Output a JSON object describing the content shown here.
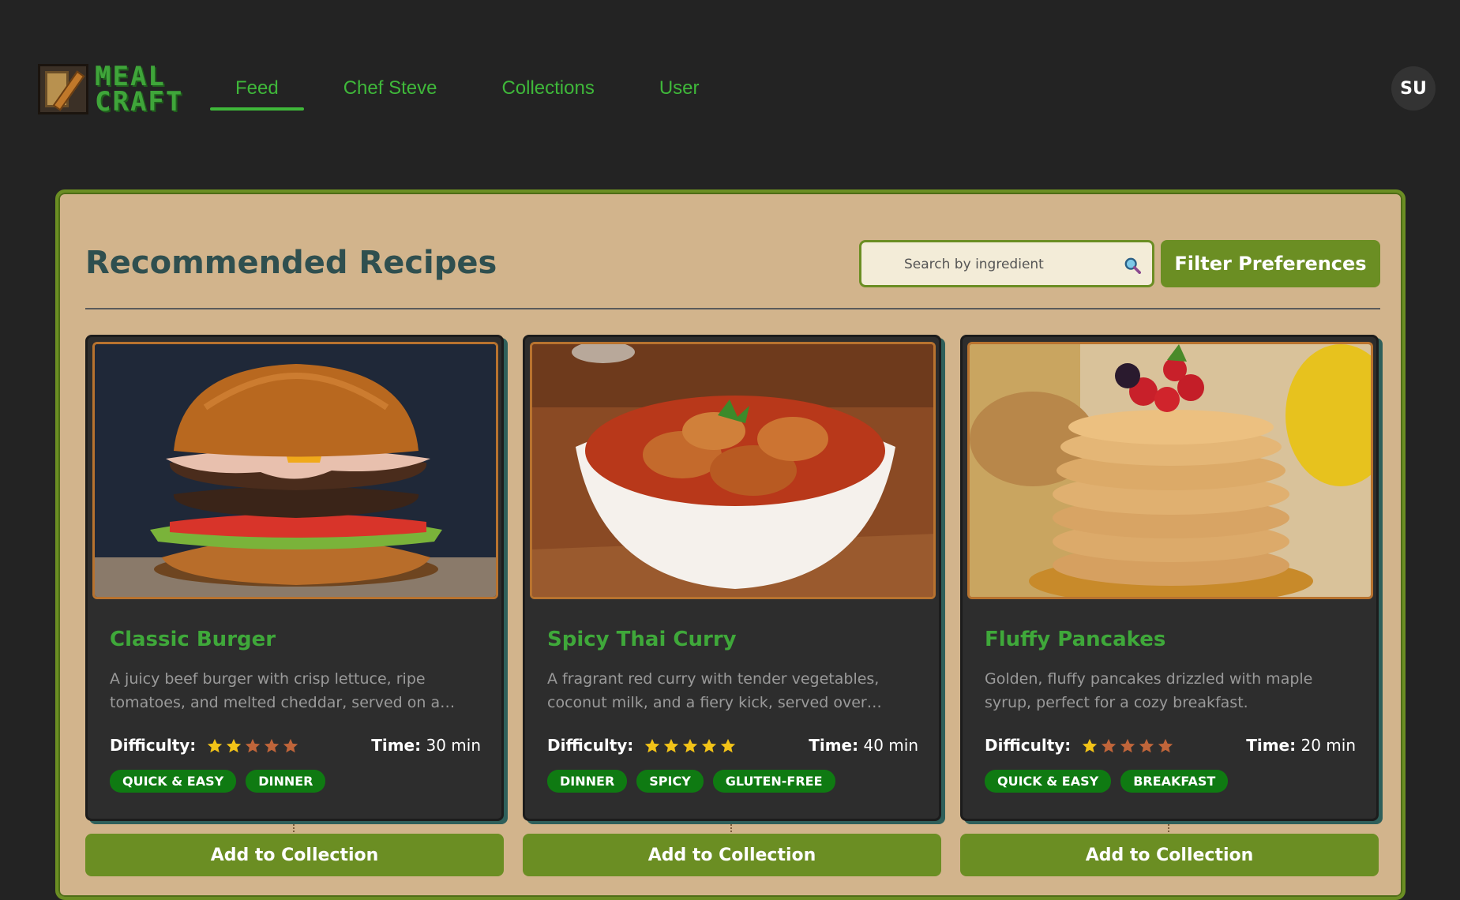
{
  "brand": {
    "line1": "MEAL",
    "line2": "CRAFT"
  },
  "nav": {
    "items": [
      {
        "label": "Feed",
        "active": true
      },
      {
        "label": "Chef Steve",
        "active": false
      },
      {
        "label": "Collections",
        "active": false
      },
      {
        "label": "User",
        "active": false
      }
    ]
  },
  "user": {
    "initials": "SU"
  },
  "main": {
    "title": "Recommended Recipes",
    "search_placeholder": "Search by ingredient",
    "filter_label": "Filter Preferences"
  },
  "colors": {
    "accent": "#6b8e23",
    "link_green": "#3fb83a",
    "panel_bg": "#d2b48c",
    "card_bg": "#2d2d2d",
    "tag_bg": "#0f7a12",
    "star_on": "#f2c318",
    "star_off": "#c0653a"
  },
  "recipes": [
    {
      "title": "Classic Burger",
      "description": "A juicy beef burger with crisp lettuce, ripe tomatoes, and melted cheddar, served on a…",
      "difficulty_label": "Difficulty:",
      "difficulty": 2,
      "time_label": "Time:",
      "time": "30 min",
      "tags": [
        "QUICK & EASY",
        "DINNER"
      ],
      "image": "burger",
      "button": "Add to Collection"
    },
    {
      "title": "Spicy Thai Curry",
      "description": "A fragrant red curry with tender vegetables, coconut milk, and a fiery kick, served over…",
      "difficulty_label": "Difficulty:",
      "difficulty": 5,
      "time_label": "Time:",
      "time": "40 min",
      "tags": [
        "DINNER",
        "SPICY",
        "GLUTEN-FREE"
      ],
      "image": "curry",
      "button": "Add to Collection"
    },
    {
      "title": "Fluffy Pancakes",
      "description": "Golden, fluffy pancakes drizzled with maple syrup, perfect for a cozy breakfast.",
      "difficulty_label": "Difficulty:",
      "difficulty": 1,
      "time_label": "Time:",
      "time": "20 min",
      "tags": [
        "QUICK & EASY",
        "BREAKFAST"
      ],
      "image": "pancakes",
      "button": "Add to Collection"
    }
  ]
}
